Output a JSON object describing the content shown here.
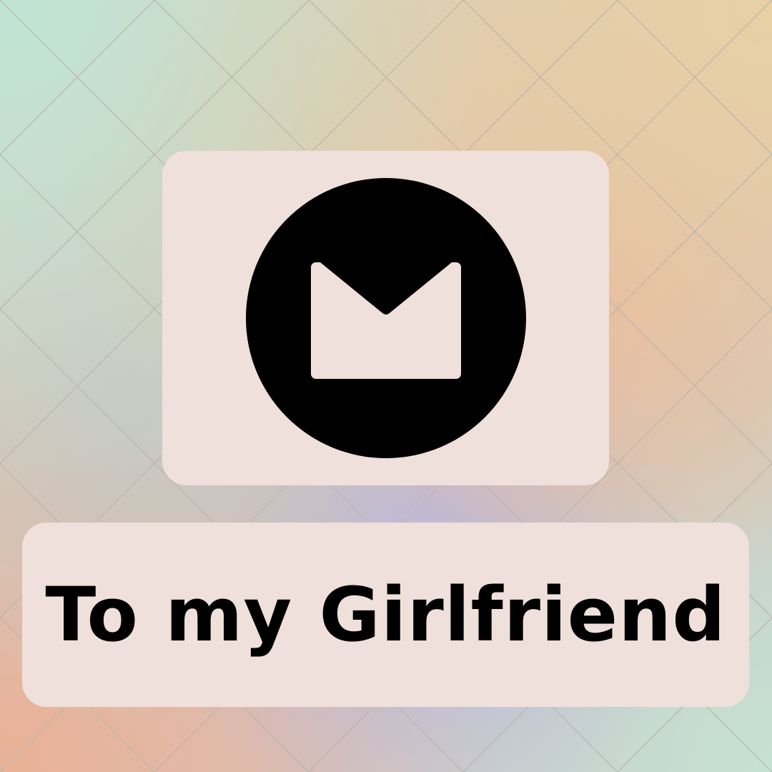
{
  "title": "To my Girlfriend",
  "icon": "mail-envelope-icon",
  "colors": {
    "plate": "#efe0db",
    "icon": "#000000",
    "text": "#000000",
    "grid_line": "#b9b4ab"
  }
}
